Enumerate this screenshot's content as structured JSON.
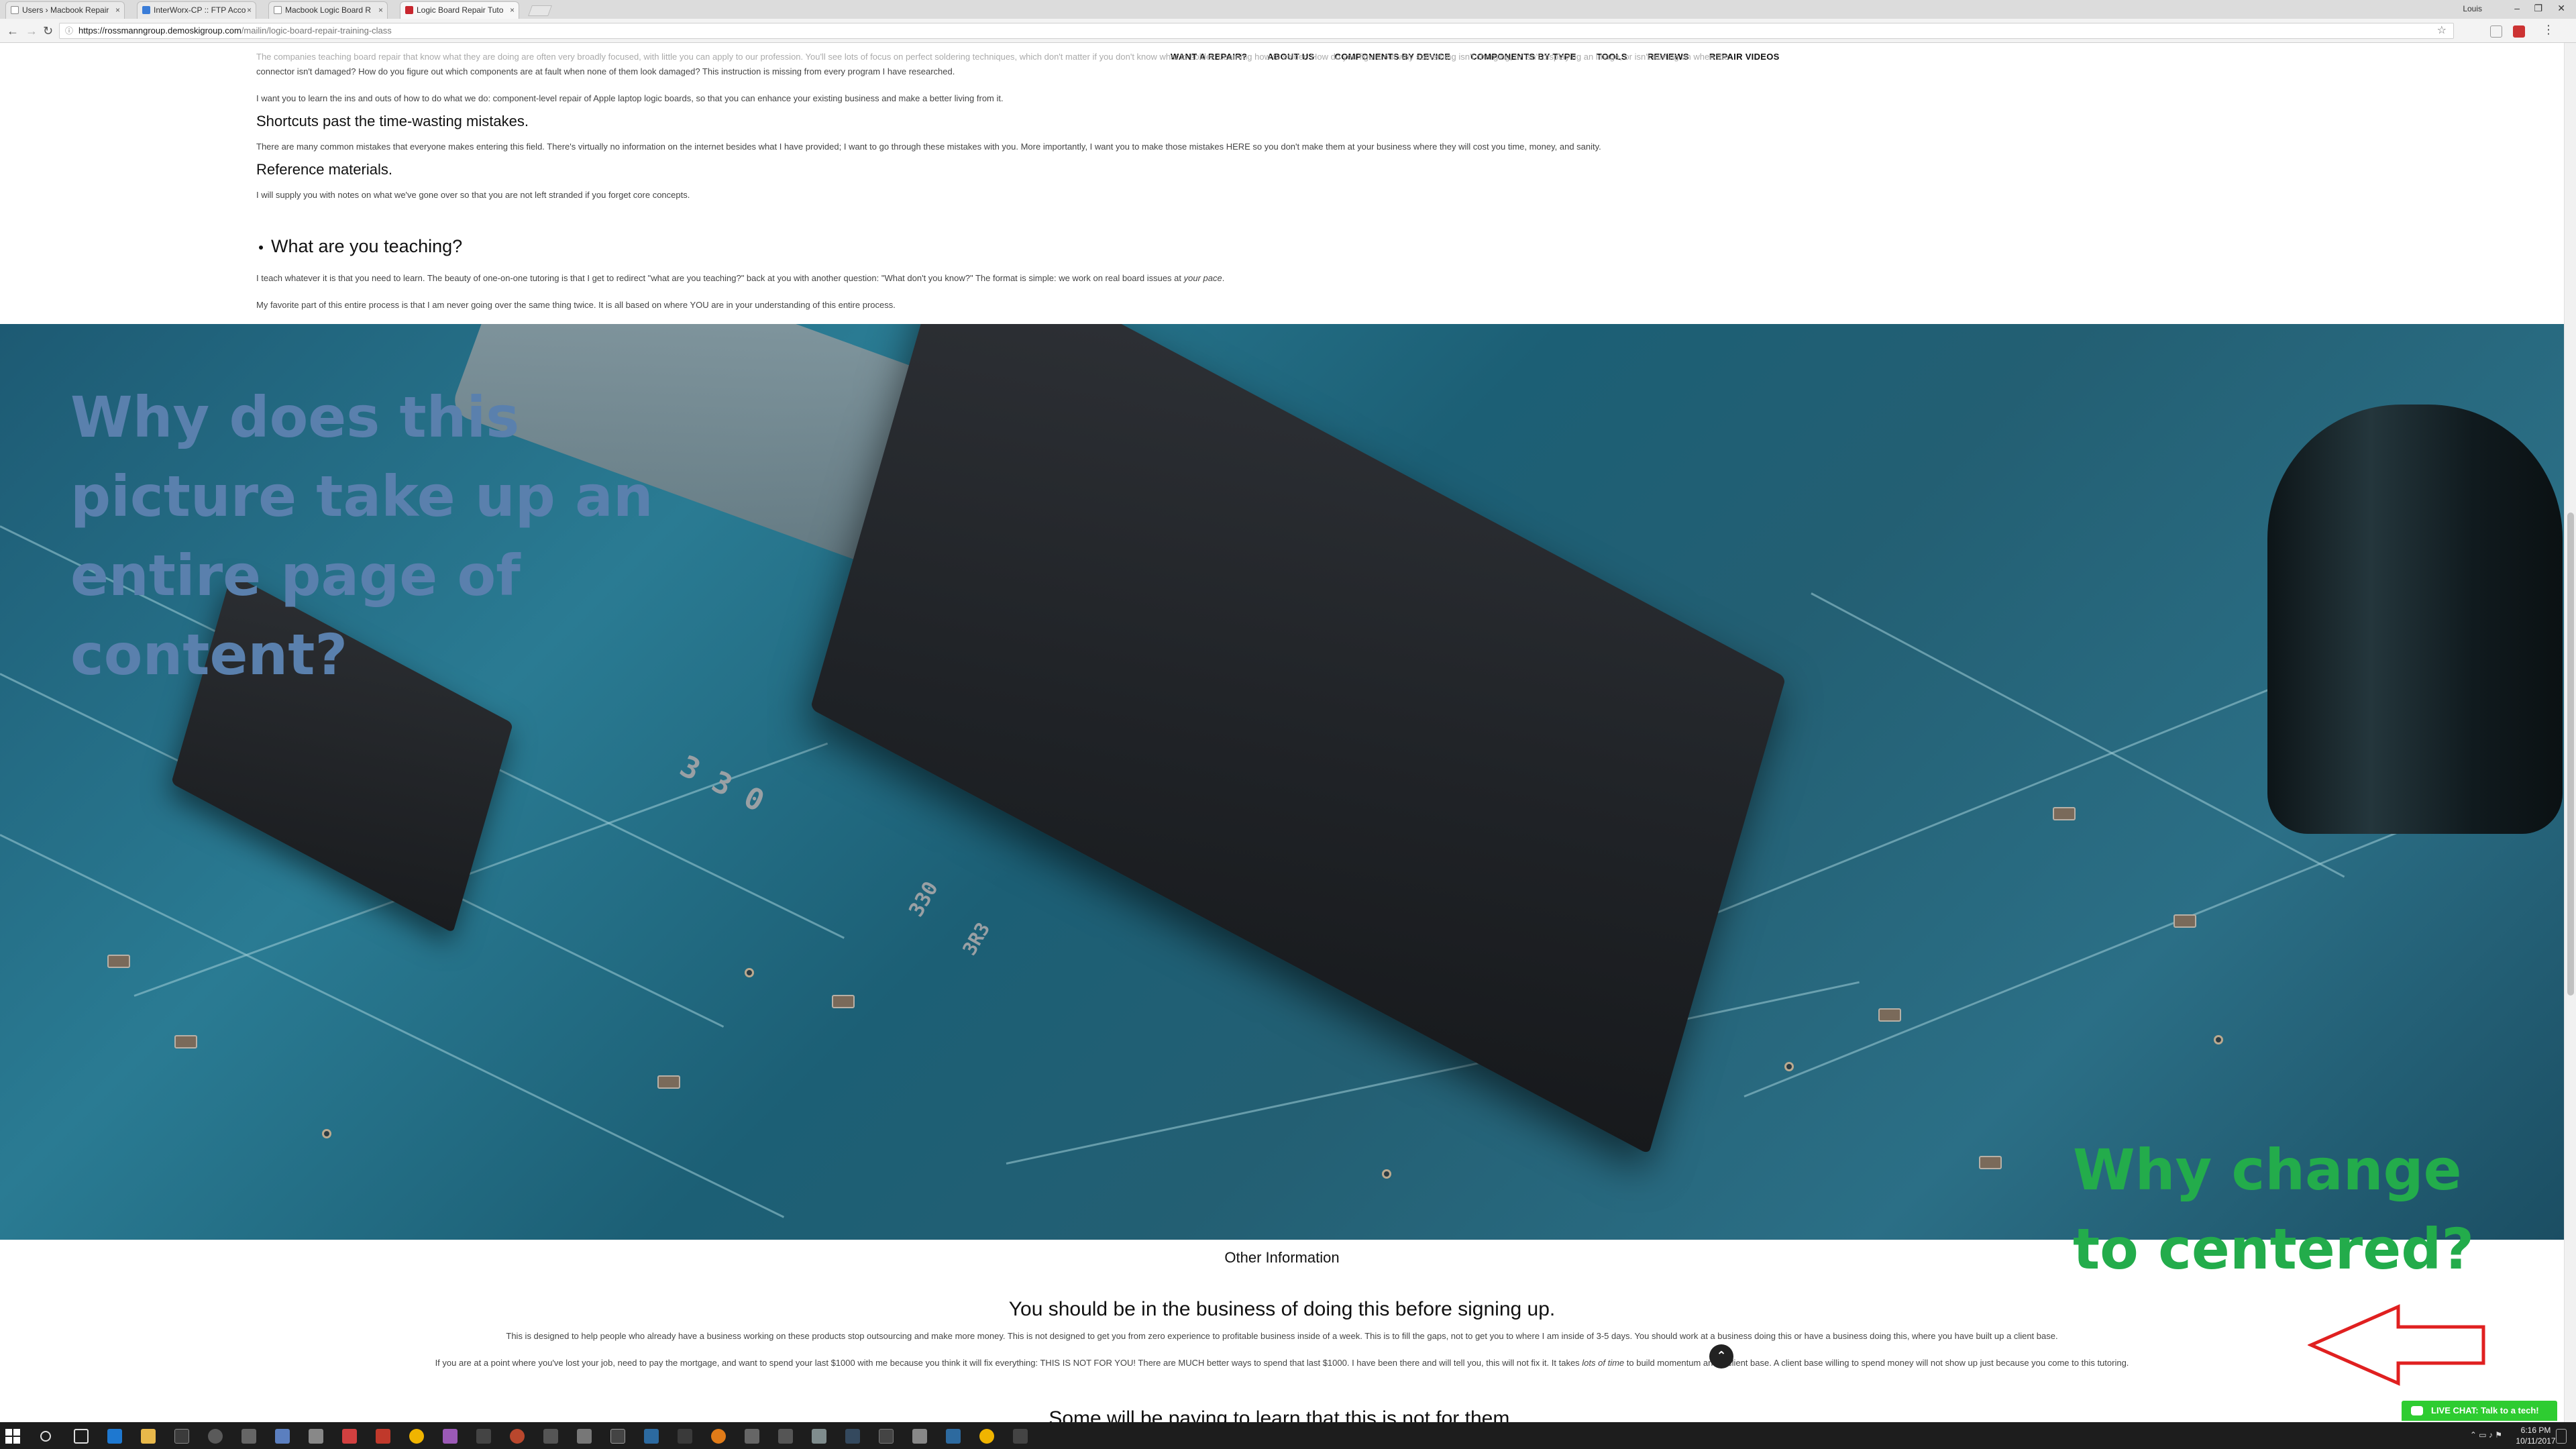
{
  "browser": {
    "tabs": [
      {
        "label": "Users › Macbook Repair"
      },
      {
        "label": "InterWorx-CP :: FTP Acco"
      },
      {
        "label": "Macbook Logic Board R"
      },
      {
        "label": "Logic Board Repair Tuto"
      }
    ],
    "user": "Louis",
    "url_host": "https://rossmanngroup.demoskigroup.com",
    "url_path": "/mailin/logic-board-repair-training-class"
  },
  "nav": {
    "items": [
      "WANT A REPAIR?",
      "ABOUT US",
      "COMPONENTS BY DEVICE",
      "COMPONENTS BY TYPE",
      "TOOLS",
      "REVIEWS",
      "REPAIR VIDEOS"
    ]
  },
  "content": {
    "faded_line": "The companies teaching board repair that know what they are doing are often very broadly focused, with little you can apply to our profession. You'll see lots of focus on perfect soldering techniques, which don't matter if you don't know what to solder. Learning how to solder. How do you figure out why something isn't charging, or isn't displaying an image, or isn't turning on when the",
    "line1": "connector isn't damaged? How do you figure out which components are at fault when none of them look damaged? This instruction is missing from every program I have researched.",
    "line2": "I want you to learn the ins and outs of how to do what we do: component-level repair of Apple laptop logic boards, so that you can enhance your existing business and make a better living from it.",
    "heading_shortcuts": "Shortcuts past the time-wasting mistakes.",
    "shortcuts_text": "There are many common mistakes that everyone makes entering this field. There's virtually no information on the internet besides what I have provided; I want to go through these mistakes with you. More importantly, I want you to make those mistakes HERE so you don't make them at your business where they will cost you time, money, and sanity.",
    "heading_reference": "Reference materials.",
    "reference_text": "I will supply you with notes on what we've gone over so that you are not left stranded if you forget core concepts.",
    "heading_teaching": "What are you teaching?",
    "teaching_text_a": "I teach whatever it is that you need to learn. The beauty of one-on-one tutoring is that I get to redirect \"what are you teaching?\" back at you with another question: \"What don't you know?\" The format is simple: we work on real board issues at ",
    "teaching_text_em": "your pace",
    "teaching_text_b": ".",
    "teaching_text2": "My favorite part of this entire process is that I am never going over the same thing twice. It is all based on where YOU are in your understanding of this entire process."
  },
  "hero": {
    "chip_label_1": "3 3 0",
    "chip_label_2": "330",
    "chip_label_3": "3R3"
  },
  "annotations": {
    "blue": "Why does this picture take up an entire page of content?",
    "green": "Why change to centered?"
  },
  "lower": {
    "other_info": "Other Information",
    "heading_business": "You should be in the business of doing this before signing up.",
    "para1": "This is designed to help people who already have a business working on these products stop outsourcing and make more money. This is not designed to get you from zero experience to profitable business inside of a week. This is to fill the gaps, not to get you to where I am inside of 3-5 days. You should work at a business doing this or have a business doing this, where you have built up a client base.",
    "para2_a": "If you are at a point where you've lost your job, need to pay the mortgage, and want to spend your last $1000 with me because you think it will fix everything: THIS IS NOT FOR YOU! There are MUCH better ways to spend that last $1000. I have been there and will tell you, this will not fix it. It takes ",
    "para2_em": "lots of time",
    "para2_b": " to build momentum and a client base. A client base willing to spend money will not show up just because you come to this tutoring.",
    "heading_next": "Some will be paying to learn that this is not for them."
  },
  "livechat": {
    "label": "LIVE CHAT: Talk to a tech!"
  },
  "taskbar": {
    "time": "6:16 PM",
    "date": "10/11/2017"
  },
  "colors": {
    "annotation_blue": "#5a80ad",
    "annotation_green": "#23ac4b",
    "arrow_red": "#e02020",
    "livechat_green": "#2ecc31"
  }
}
